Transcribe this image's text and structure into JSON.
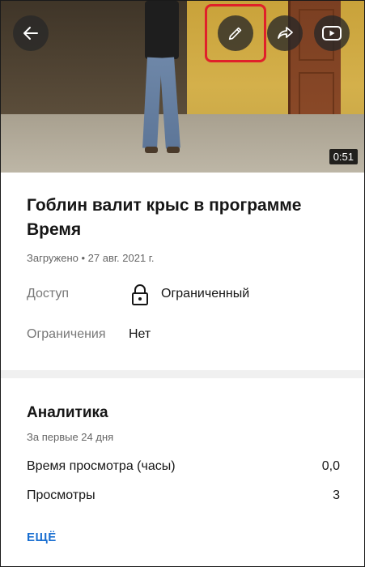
{
  "video": {
    "duration": "0:51"
  },
  "toolbar": {
    "back_icon": "arrow-left-icon",
    "edit_icon": "pencil-icon",
    "share_icon": "share-arrow-icon",
    "youtube_icon": "youtube-play-icon"
  },
  "details": {
    "title": "Гоблин валит крыс в программе Время",
    "uploaded": "Загружено • 27 авг. 2021 г.",
    "access_label": "Доступ",
    "access_value": "Ограниченный",
    "restrictions_label": "Ограничения",
    "restrictions_value": "Нет"
  },
  "analytics": {
    "title": "Аналитика",
    "period": "За первые 24 дня",
    "rows": [
      {
        "label": "Время просмотра (часы)",
        "value": "0,0"
      },
      {
        "label": "Просмотры",
        "value": "3"
      }
    ],
    "more_label": "ЕЩЁ"
  },
  "colors": {
    "highlight": "#e0202a",
    "link": "#1a6fd1"
  }
}
